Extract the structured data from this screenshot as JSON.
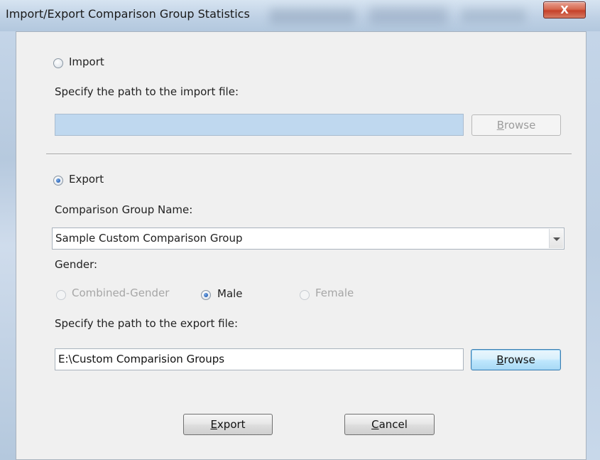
{
  "window": {
    "title": "Import/Export Comparison Group Statistics",
    "close_glyph": "X"
  },
  "import": {
    "radio_label": "Import",
    "selected": false,
    "path_label": "Specify the path to the import file:",
    "path_value": "",
    "browse": {
      "mnemonic": "B",
      "rest": "rowse",
      "enabled": false
    }
  },
  "export": {
    "radio_label": "Export",
    "selected": true,
    "group_label": "Comparison Group Name:",
    "group_value": "Sample Custom Comparison Group",
    "gender_label": "Gender:",
    "gender_options": [
      {
        "label": "Combined-Gender",
        "selected": false,
        "enabled": false
      },
      {
        "label": "Male",
        "selected": true,
        "enabled": true
      },
      {
        "label": "Female",
        "selected": false,
        "enabled": false
      }
    ],
    "path_label": "Specify the path to the export file:",
    "path_value": "E:\\Custom Comparision Groups",
    "browse": {
      "mnemonic": "B",
      "rest": "rowse",
      "enabled": true
    }
  },
  "actions": {
    "export": {
      "mnemonic": "E",
      "rest": "xport"
    },
    "cancel": {
      "mnemonic": "C",
      "rest": "ancel"
    }
  },
  "colors": {
    "dialog_background": "#f0f0f0",
    "disabled_field": "#bfd8ef",
    "close_button": "#c5412a",
    "radio_selected": "#2a63b8"
  },
  "icons": {
    "close": "close-icon",
    "dropdown": "chevron-down-icon"
  }
}
